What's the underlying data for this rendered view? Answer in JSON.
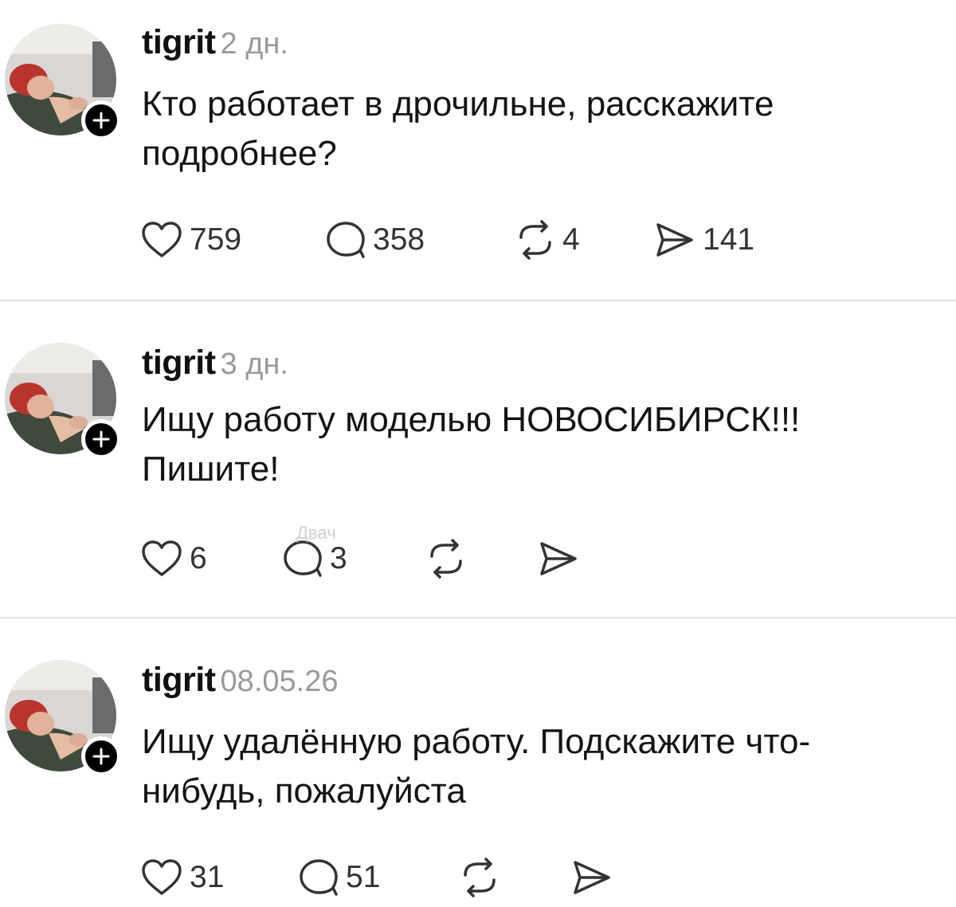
{
  "posts": [
    {
      "username": "tigrit",
      "timestamp": "2 дн.",
      "text_line1": "Кто работает в дрочильне, расскажите",
      "text_line2": "подробнее?",
      "likes": "759",
      "comments": "358",
      "reposts": "4",
      "shares": "141"
    },
    {
      "username": "tigrit",
      "timestamp": "3 дн.",
      "text_line1": "Ищу работу моделью НОВОСИБИРСК!!!",
      "text_line2": "Пишите!",
      "likes": "6",
      "comments": "3",
      "reposts": "",
      "shares": ""
    },
    {
      "username": "tigrit",
      "timestamp": "08.05.26",
      "text_line1": "Ищу удалённую работу. Подскажите что-",
      "text_line2": "нибудь, пожалуйста",
      "likes": "31",
      "comments": "51",
      "reposts": "",
      "shares": ""
    }
  ],
  "watermark": "Двач",
  "icons": {
    "like": "heart-icon",
    "comment": "comment-bubble-icon",
    "repost": "repost-icon",
    "share": "send-icon",
    "follow": "plus-icon"
  },
  "colors": {
    "text": "#111111",
    "muted": "#9a9a9a",
    "divider": "#e2e2e2",
    "badge": "#000000"
  }
}
